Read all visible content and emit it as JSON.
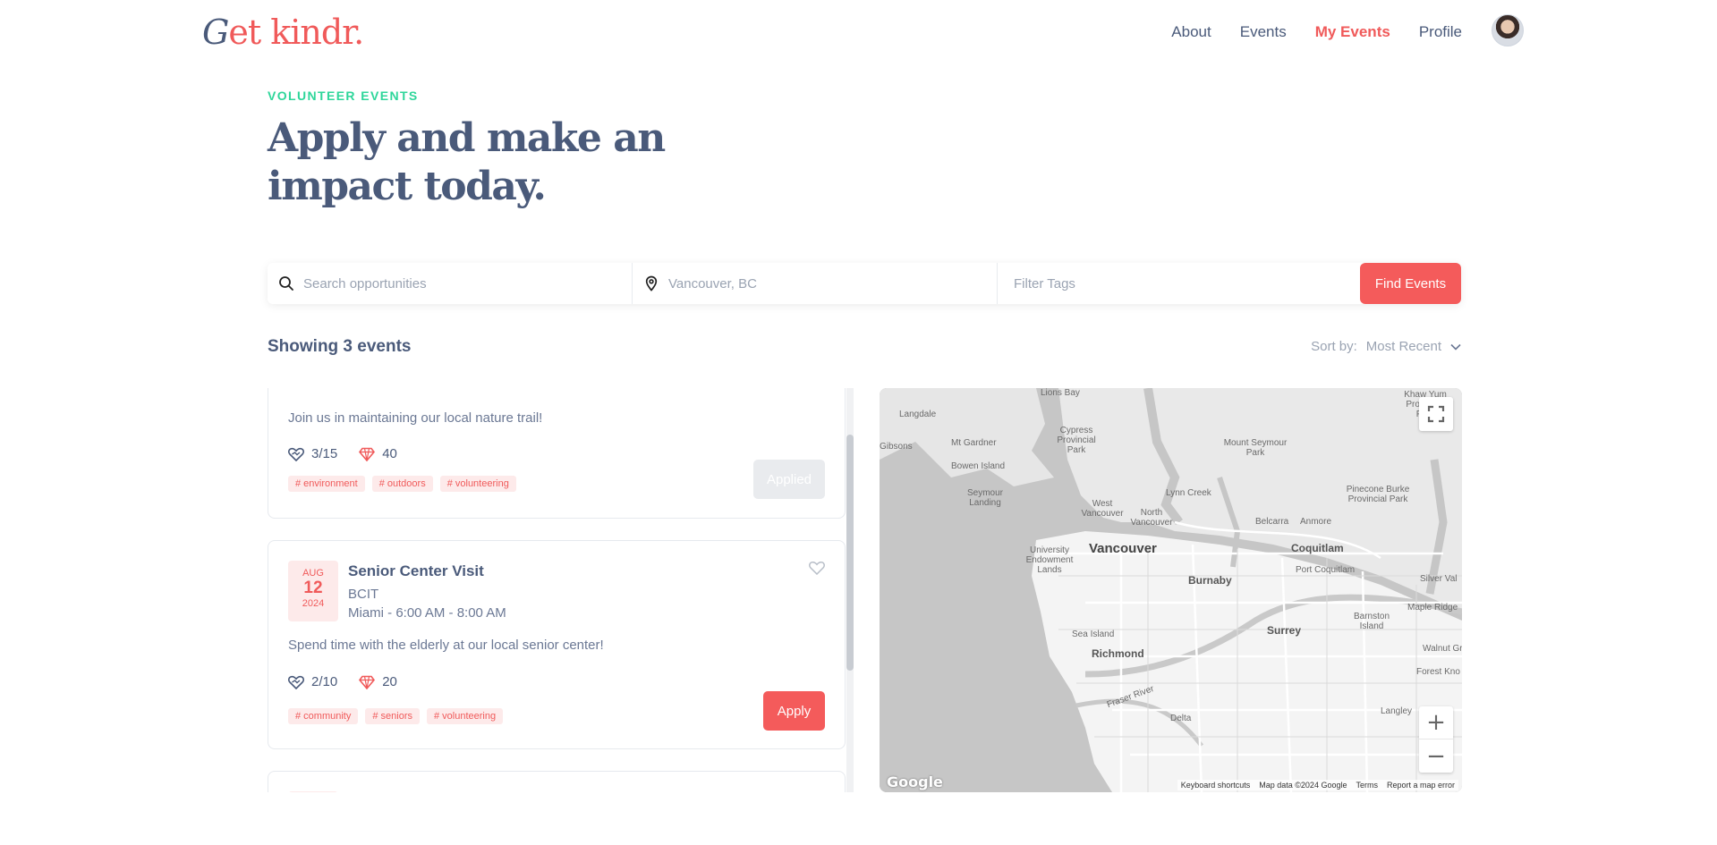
{
  "header": {
    "logo_g": "G",
    "logo_et": "et ",
    "logo_kindr": "kindr.",
    "nav": [
      "About",
      "Events",
      "My Events",
      "Profile"
    ]
  },
  "hero": {
    "eyebrow": "VOLUNTEER EVENTS",
    "title": "Apply and make an impact today."
  },
  "search": {
    "opportunities_placeholder": "Search opportunities",
    "location_placeholder": "Vancouver, BC",
    "tags_placeholder": "Filter Tags",
    "find_label": "Find Events"
  },
  "results": {
    "showing": "Showing 3 events",
    "sort_label": "Sort by:",
    "sort_value": "Most Recent"
  },
  "events": [
    {
      "description": "Join us in maintaining our local nature trail!",
      "volunteers": "3/15",
      "points": "40",
      "tags": [
        "# environment",
        "# outdoors",
        "# volunteering"
      ],
      "action": "Applied"
    },
    {
      "month": "AUG",
      "day": "12",
      "year": "2024",
      "title": "Senior Center Visit",
      "org": "BCIT",
      "time": "Miami - 6:00 AM - 8:00 AM",
      "description": "Spend time with the elderly at our local senior center!",
      "volunteers": "2/10",
      "points": "20",
      "tags": [
        "# community",
        "# seniors",
        "# volunteering"
      ],
      "action": "Apply"
    }
  ],
  "map": {
    "labels": {
      "lions_bay": "Lions Bay",
      "khaw_yum": "Khaw Yum Provincial Park",
      "langdale": "Langdale",
      "gibsons": "Gibsons",
      "mt_gardner": "Mt Gardner",
      "cypress": "Cypress Provincial Park",
      "bowen": "Bowen Island",
      "mount_seymour": "Mount Seymour Park",
      "lynn_creek": "Lynn Creek",
      "seymour_landing": "Seymour Landing",
      "west_vancouver": "West Vancouver",
      "north_vancouver": "North Vancouver",
      "belcarra": "Belcarra",
      "anmore": "Anmore",
      "pinecone": "Pinecone Burke Provincial Park",
      "ubc": "University Endowment Lands",
      "vancouver": "Vancouver",
      "coquitlam": "Coquitlam",
      "burnaby": "Burnaby",
      "port_coquitlam": "Port Coquitlam",
      "silver_valley": "Silver Val",
      "maple_ridge": "Maple Ridge",
      "sea_island": "Sea Island",
      "surrey": "Surrey",
      "barnston": "Barnston Island",
      "walnut_grove": "Walnut Grove",
      "richmond": "Richmond",
      "forest_knolls": "Forest Kno",
      "fraser_river": "Fraser River",
      "delta": "Delta",
      "langley": "Langley"
    },
    "google": "Google",
    "attribution": [
      "Keyboard shortcuts",
      "Map data ©2024 Google",
      "Terms",
      "Report a map error"
    ]
  }
}
